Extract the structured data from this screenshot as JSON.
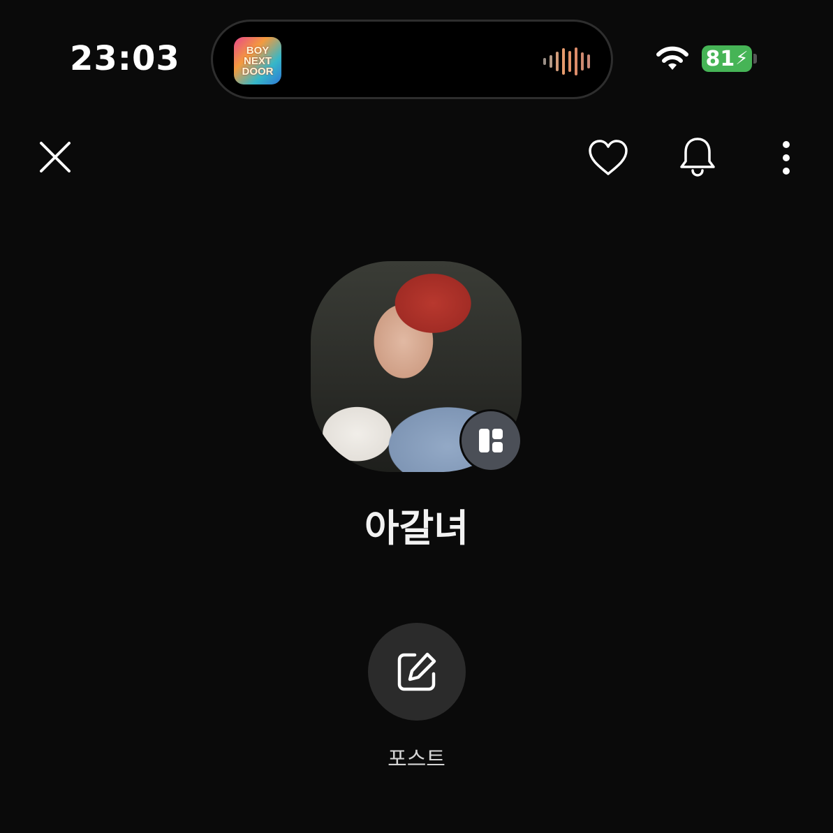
{
  "status_bar": {
    "time": "23:03",
    "battery_percent": "81",
    "battery_charging": true,
    "wifi_icon": "wifi-icon",
    "live_activity": {
      "app_icon_text": [
        "BOY",
        "NEXT",
        "DOOR"
      ],
      "indicator": "audio-waveform-icon"
    }
  },
  "top_bar": {
    "close_icon": "close-icon",
    "heart_icon": "heart-icon",
    "bell_icon": "bell-icon",
    "more_icon": "more-vertical-icon"
  },
  "profile": {
    "name": "아갈녀",
    "avatar_badge_icon": "layout-grid-icon"
  },
  "actions": {
    "post_icon": "edit-icon",
    "post_label": "포스트"
  },
  "colors": {
    "background": "#0a0a0a",
    "battery": "#46b456",
    "badge": "#4b4f57",
    "post_button": "#2b2b2b"
  }
}
